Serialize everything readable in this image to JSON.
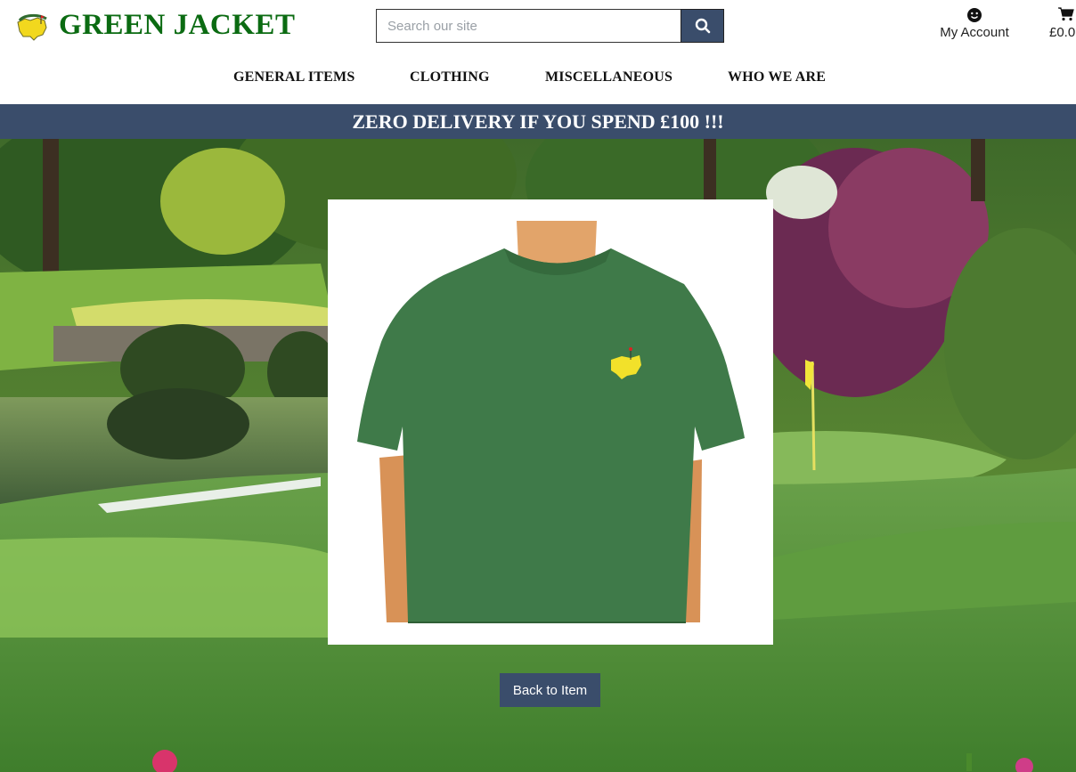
{
  "brand": {
    "name": "GREEN JACKET",
    "logo_icon": "masters-logo-icon",
    "color": "#0b6b12"
  },
  "search": {
    "placeholder": "Search our site",
    "value": "",
    "button_icon": "search-icon"
  },
  "account": {
    "label": "My Account",
    "icon": "smiley-icon"
  },
  "cart": {
    "total": "£0.0",
    "icon": "cart-icon"
  },
  "nav": {
    "items": [
      {
        "label": "GENERAL ITEMS"
      },
      {
        "label": "CLOTHING"
      },
      {
        "label": "MISCELLANEOUS"
      },
      {
        "label": "WHO WE ARE"
      }
    ]
  },
  "banner": {
    "text": "ZERO DELIVERY IF YOU SPEND £100 !!!"
  },
  "product": {
    "image_icon": "green-tshirt-image"
  },
  "actions": {
    "back_label": "Back to Item"
  },
  "colors": {
    "accent": "#3a4d6b",
    "brand": "#0b6b12",
    "shirt": "#3f7a49"
  }
}
